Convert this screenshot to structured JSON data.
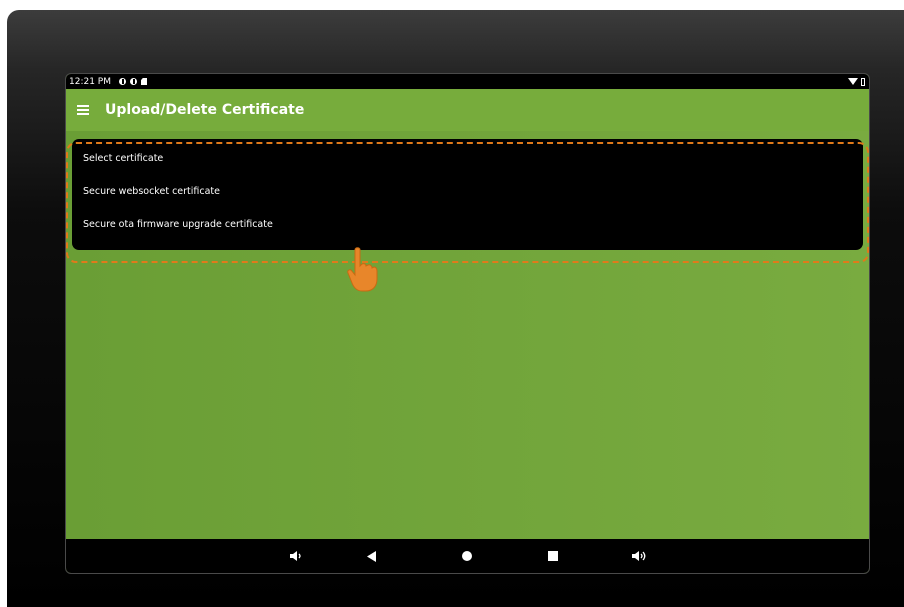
{
  "status_bar": {
    "time": "12:21 PM"
  },
  "app_bar": {
    "title": "Upload/Delete Certificate",
    "menu_icon": "menu-icon"
  },
  "dropdown": {
    "items": [
      "Select certificate",
      "Secure websocket certificate",
      "Secure ota firmware upgrade certificate"
    ]
  },
  "nav_bar": {
    "buttons": [
      "volume-down-icon",
      "back-icon",
      "home-icon",
      "recents-icon",
      "volume-up-icon"
    ]
  },
  "colors": {
    "app_bar": "#77ac3c",
    "content": "#6f9d36",
    "highlight": "#e07a1a"
  }
}
